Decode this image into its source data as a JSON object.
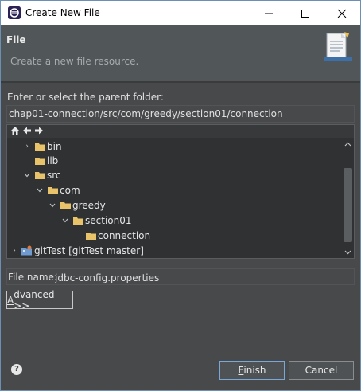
{
  "window": {
    "title": "Create New File",
    "controls": {
      "minimize": "—",
      "maximize": "☐",
      "close": "✕"
    }
  },
  "header": {
    "title": "File",
    "description": "Create a new file resource."
  },
  "parent_folder": {
    "label": "Enter or select the parent folder:",
    "value": "chap01-connection/src/com/greedy/section01/connection"
  },
  "tree": {
    "toolbar_icons": [
      "home-icon",
      "back-arrow-icon",
      "forward-arrow-icon"
    ],
    "items": [
      {
        "label": "bin",
        "expanded": false,
        "has_children": true,
        "icon": "folder-icon"
      },
      {
        "label": "lib",
        "expanded": false,
        "has_children": false,
        "icon": "folder-icon"
      },
      {
        "label": "src",
        "expanded": true,
        "has_children": true,
        "icon": "folder-icon"
      },
      {
        "label": "com",
        "expanded": true,
        "has_children": true,
        "icon": "folder-icon"
      },
      {
        "label": "greedy",
        "expanded": true,
        "has_children": true,
        "icon": "folder-icon"
      },
      {
        "label": "section01",
        "expanded": true,
        "has_children": true,
        "icon": "folder-icon"
      },
      {
        "label": "connection",
        "expanded": false,
        "has_children": false,
        "icon": "folder-icon"
      },
      {
        "label": "gitTest [gitTest master]",
        "expanded": false,
        "has_children": true,
        "icon": "git-project-icon"
      }
    ]
  },
  "file_name": {
    "label": "File name:",
    "value": "jdbc-config.properties"
  },
  "buttons": {
    "advanced_mnemonic": "A",
    "advanced_rest": "dvanced >>",
    "finish_mnemonic": "F",
    "finish_rest": "inish",
    "cancel": "Cancel"
  },
  "help": {
    "glyph": "?"
  },
  "colors": {
    "background": "#48494b",
    "header_band": "#515658",
    "tree_background": "#2f3133",
    "folder": "#e8c36a",
    "text": "#e0e0e0",
    "accent_border": "#7aa7d8"
  }
}
